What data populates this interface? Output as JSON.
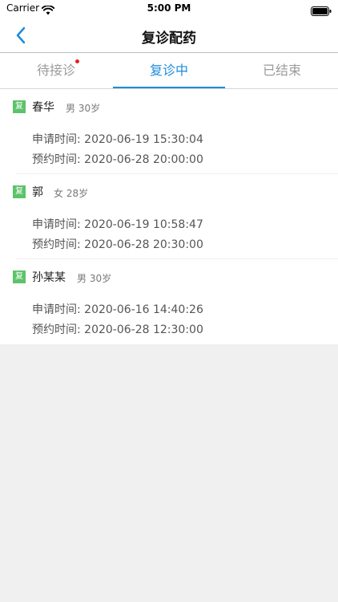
{
  "status_bar": {
    "carrier": "Carrier",
    "time": "5:00 PM"
  },
  "nav": {
    "title": "复诊配药"
  },
  "tabs": [
    {
      "label": "待接诊",
      "has_notification": true
    },
    {
      "label": "复诊中",
      "active": true
    },
    {
      "label": "已结束"
    }
  ],
  "colors": {
    "accent": "#1c8ddb",
    "badge_green": "#5cc36a",
    "notification_red": "#e0241c"
  },
  "patients": [
    {
      "badge": "复",
      "name": "春华",
      "meta": "男 30岁",
      "apply_time": "申请时间: 2020-06-19 15:30:04",
      "appointment_time": "预约时间: 2020-06-28 20:00:00"
    },
    {
      "badge": "复",
      "name": "郭",
      "meta": "女 28岁",
      "apply_time": "申请时间: 2020-06-19 10:58:47",
      "appointment_time": "预约时间: 2020-06-28 20:30:00"
    },
    {
      "badge": "复",
      "name": "孙某某",
      "meta": "男 30岁",
      "apply_time": "申请时间: 2020-06-16 14:40:26",
      "appointment_time": "预约时间: 2020-06-28 12:30:00"
    }
  ]
}
